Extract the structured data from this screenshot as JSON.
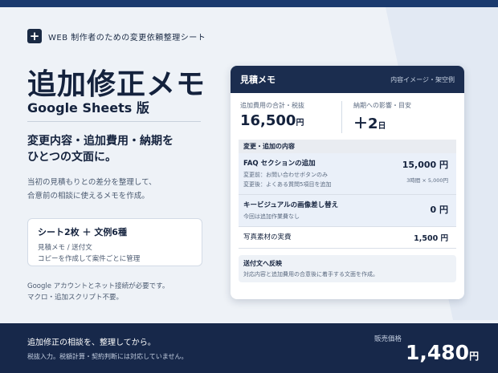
{
  "eyebrow": {
    "icon": "plus-icon",
    "text": "WEB 制作者のための変更依頼整理シート"
  },
  "title": "追加修正メモ",
  "subtitle": "Google Sheets 版",
  "headline": {
    "line1": "変更内容・追加費用・納期を",
    "line2": "ひとつの文面に。"
  },
  "description": {
    "line1": "当初の見積もりとの差分を整理して、",
    "line2": "合意前の相談に使えるメモを作成。"
  },
  "info_box": {
    "title": "シート2枚 ＋ 文例6種",
    "line1": "見積メモ / 送付文",
    "line2": "コピーを作成して案件ごとに管理"
  },
  "note": {
    "line1": "Google アカウントとネット接続が必要です。",
    "line2": "マクロ・追加スクリプト不要。"
  },
  "card": {
    "title": "見積メモ",
    "tag": "内容イメージ・架空例",
    "summary": {
      "cost_label": "追加費用の合計・税抜",
      "cost_value": "16,500",
      "cost_unit": "円",
      "delay_label": "納期への影響・目安",
      "delay_value": "＋2",
      "delay_unit": "日"
    },
    "section_label": "変更・追加の内容",
    "rows": [
      {
        "title": "FAQ セクションの追加",
        "before": "変更前：お問い合わせボタンのみ",
        "after": "変更後：よくある質問5項目を追加",
        "amount": "15,000 円",
        "calc": "3時間 × 5,000円"
      },
      {
        "title": "キービジュアルの画像差し替え",
        "note": "今回は追加作業費なし",
        "amount": "0 円"
      },
      {
        "title": "写真素材の実費",
        "amount": "1,500 円"
      }
    ],
    "send": {
      "title": "送付文へ反映",
      "text": "対応内容と追加費用の合意後に着手する文面を作成。"
    }
  },
  "footer": {
    "main": "追加修正の相談を、整理してから。",
    "sub": "税抜入力。税額計算・契約判断には対応していません。",
    "price_label": "販売価格",
    "price_value": "1,480",
    "price_unit": "円"
  },
  "colors": {
    "navy": "#1a2a44",
    "accent_bar": "#1a3a6e",
    "footer": "#17284a"
  }
}
